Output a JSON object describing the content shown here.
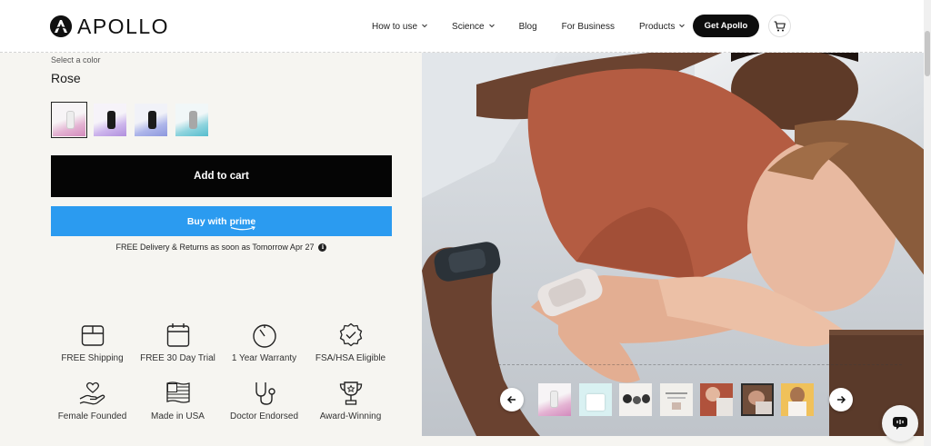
{
  "header": {
    "brand": "APOLLO",
    "nav": [
      {
        "label": "How to use",
        "has_dropdown": true
      },
      {
        "label": "Science",
        "has_dropdown": true
      },
      {
        "label": "Blog",
        "has_dropdown": false
      },
      {
        "label": "For Business",
        "has_dropdown": false
      },
      {
        "label": "Products",
        "has_dropdown": true
      }
    ],
    "cta_label": "Get Apollo",
    "cart_icon": "cart-icon"
  },
  "product": {
    "select_color_label": "Select a color",
    "selected_color": "Rose",
    "swatches": [
      {
        "name": "rose",
        "band": "#efefef",
        "bg_from": "#f5f2f5",
        "bg_to": "#d99ac6",
        "selected": true
      },
      {
        "name": "lavender",
        "band": "#1a1a1a",
        "bg_from": "#f4f0f8",
        "bg_to": "#b99be0",
        "selected": false
      },
      {
        "name": "periwinkle",
        "band": "#1a1a1a",
        "bg_from": "#eef0f8",
        "bg_to": "#8e9be0",
        "selected": false
      },
      {
        "name": "aqua",
        "band": "#a8a8a8",
        "bg_from": "#eef6f8",
        "bg_to": "#63c2d2",
        "selected": false
      }
    ],
    "add_to_cart_label": "Add to cart",
    "buy_with_label": "Buy with",
    "prime_label": "prime",
    "delivery_text": "FREE Delivery & Returns as soon as Tomorrow Apr 27",
    "info_glyph": "i"
  },
  "features": [
    {
      "label": "FREE Shipping",
      "icon": "box-icon"
    },
    {
      "label": "FREE 30 Day Trial",
      "icon": "calendar-icon"
    },
    {
      "label": "1 Year Warranty",
      "icon": "timer-icon"
    },
    {
      "label": "FSA/HSA Eligible",
      "icon": "check-badge-icon"
    },
    {
      "label": "Female Founded",
      "icon": "heart-hand-icon"
    },
    {
      "label": "Made in USA",
      "icon": "flag-icon"
    },
    {
      "label": "Doctor Endorsed",
      "icon": "stethoscope-icon"
    },
    {
      "label": "Award-Winning",
      "icon": "trophy-icon"
    }
  ],
  "gallery": {
    "thumbnails": 7,
    "prev_icon": "arrow-left-icon",
    "next_icon": "arrow-right-icon"
  },
  "chat_icon": "chat-icon",
  "colors": {
    "cta_black": "#0d0d0d",
    "prime_blue": "#2b9bf0",
    "page_bg": "#f6f5f1"
  }
}
